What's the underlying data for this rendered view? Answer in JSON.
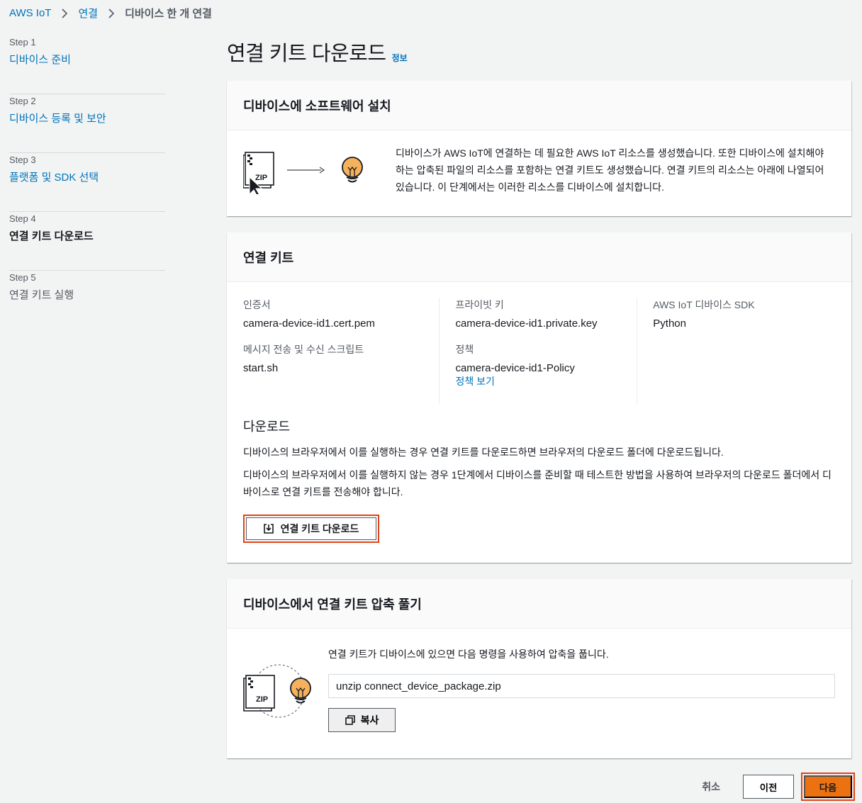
{
  "breadcrumb": [
    "AWS IoT",
    "연결",
    "디바이스 한 개 연결"
  ],
  "steps": [
    {
      "num": "Step 1",
      "label": "디바이스 준비",
      "state": "link"
    },
    {
      "num": "Step 2",
      "label": "디바이스 등록 및 보안",
      "state": "link"
    },
    {
      "num": "Step 3",
      "label": "플랫폼 및 SDK 선택",
      "state": "link"
    },
    {
      "num": "Step 4",
      "label": "연결 키트 다운로드",
      "state": "active"
    },
    {
      "num": "Step 5",
      "label": "연결 키트 실행",
      "state": "disabled"
    }
  ],
  "page": {
    "title": "연결 키트 다운로드",
    "info": "정보"
  },
  "install": {
    "title": "디바이스에 소프트웨어 설치",
    "zip_label": "ZIP",
    "description": "디바이스가 AWS IoT에 연결하는 데 필요한 AWS IoT 리소스를 생성했습니다. 또한 디바이스에 설치해야 하는 압축된 파일의 리소스를 포함하는 연결 키트도 생성했습니다. 연결 키트의 리소스는 아래에 나열되어 있습니다. 이 단계에서는 이러한 리소스를 디바이스에 설치합니다."
  },
  "kit": {
    "title": "연결 키트",
    "cert_label": "인증서",
    "cert_value": "camera-device-id1.cert.pem",
    "script_label": "메시지 전송 및 수신 스크립트",
    "script_value": "start.sh",
    "key_label": "프라이빗 키",
    "key_value": "camera-device-id1.private.key",
    "policy_label": "정책",
    "policy_value": "camera-device-id1-Policy",
    "policy_link": "정책 보기",
    "sdk_label": "AWS IoT 디바이스 SDK",
    "sdk_value": "Python",
    "download_title": "다운로드",
    "download_text1": "디바이스의 브라우저에서 이를 실행하는 경우 연결 키트를 다운로드하면 브라우저의 다운로드 폴더에 다운로드됩니다.",
    "download_text2": "디바이스의 브라우저에서 이를 실행하지 않는 경우 1단계에서 디바이스를 준비할 때 테스트한 방법을 사용하여 브라우저의 다운로드 폴더에서 디바이스로 연결 키트를 전송해야 합니다.",
    "download_button": "연결 키트 다운로드"
  },
  "unzip": {
    "title": "디바이스에서 연결 키트 압축 풀기",
    "zip_label": "ZIP",
    "text": "연결 키트가 디바이스에 있으면 다음 명령을 사용하여 압축을 풉니다.",
    "command": "unzip connect_device_package.zip",
    "copy_button": "복사"
  },
  "footer": {
    "cancel": "취소",
    "previous": "이전",
    "next": "다음"
  },
  "colors": {
    "link": "#0073bb",
    "primary": "#ec7211",
    "highlight": "#e0431a",
    "bulb": "#f5b15c"
  }
}
